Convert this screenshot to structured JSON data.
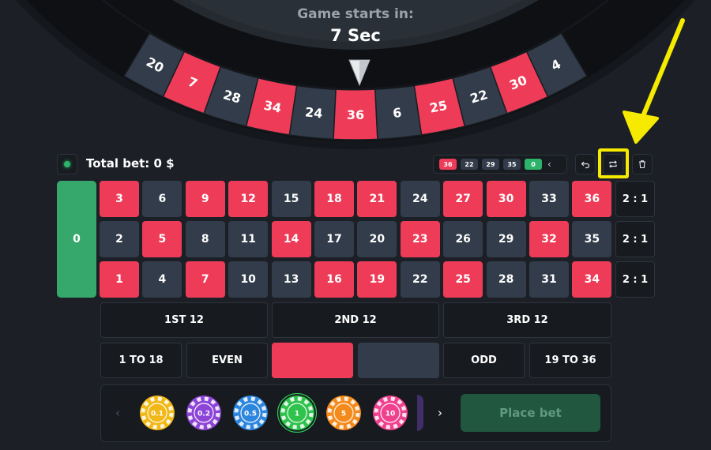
{
  "countdown": {
    "label": "Game starts in:",
    "value": "7 Sec"
  },
  "wheel": {
    "pockets": [
      {
        "number": "20",
        "color": "dark"
      },
      {
        "number": "7",
        "color": "red"
      },
      {
        "number": "28",
        "color": "dark"
      },
      {
        "number": "34",
        "color": "red"
      },
      {
        "number": "24",
        "color": "dark"
      },
      {
        "number": "36",
        "color": "red"
      },
      {
        "number": "6",
        "color": "dark"
      },
      {
        "number": "25",
        "color": "red"
      },
      {
        "number": "22",
        "color": "dark"
      },
      {
        "number": "30",
        "color": "red"
      },
      {
        "number": "4",
        "color": "dark"
      }
    ]
  },
  "header": {
    "total_bet": "Total bet: 0 $"
  },
  "history": [
    {
      "number": "36",
      "color": "red"
    },
    {
      "number": "22",
      "color": "dark"
    },
    {
      "number": "29",
      "color": "dark"
    },
    {
      "number": "35",
      "color": "dark"
    },
    {
      "number": "0",
      "color": "green"
    }
  ],
  "toolbar": {
    "undo_icon": "undo-icon",
    "repeat_icon": "repeat-icon",
    "clear_icon": "trash-icon"
  },
  "table": {
    "zero": "0",
    "rows": [
      [
        {
          "n": "3",
          "c": "red"
        },
        {
          "n": "6",
          "c": "dark"
        },
        {
          "n": "9",
          "c": "red"
        },
        {
          "n": "12",
          "c": "red"
        },
        {
          "n": "15",
          "c": "dark"
        },
        {
          "n": "18",
          "c": "red"
        },
        {
          "n": "21",
          "c": "red"
        },
        {
          "n": "24",
          "c": "dark"
        },
        {
          "n": "27",
          "c": "red"
        },
        {
          "n": "30",
          "c": "red"
        },
        {
          "n": "33",
          "c": "dark"
        },
        {
          "n": "36",
          "c": "red"
        }
      ],
      [
        {
          "n": "2",
          "c": "dark"
        },
        {
          "n": "5",
          "c": "red"
        },
        {
          "n": "8",
          "c": "dark"
        },
        {
          "n": "11",
          "c": "dark"
        },
        {
          "n": "14",
          "c": "red"
        },
        {
          "n": "17",
          "c": "dark"
        },
        {
          "n": "20",
          "c": "dark"
        },
        {
          "n": "23",
          "c": "red"
        },
        {
          "n": "26",
          "c": "dark"
        },
        {
          "n": "29",
          "c": "dark"
        },
        {
          "n": "32",
          "c": "red"
        },
        {
          "n": "35",
          "c": "dark"
        }
      ],
      [
        {
          "n": "1",
          "c": "red"
        },
        {
          "n": "4",
          "c": "dark"
        },
        {
          "n": "7",
          "c": "red"
        },
        {
          "n": "10",
          "c": "dark"
        },
        {
          "n": "13",
          "c": "dark"
        },
        {
          "n": "16",
          "c": "red"
        },
        {
          "n": "19",
          "c": "red"
        },
        {
          "n": "22",
          "c": "dark"
        },
        {
          "n": "25",
          "c": "red"
        },
        {
          "n": "28",
          "c": "dark"
        },
        {
          "n": "31",
          "c": "dark"
        },
        {
          "n": "34",
          "c": "red"
        }
      ]
    ],
    "column_bets": [
      "2 : 1",
      "2 : 1",
      "2 : 1"
    ],
    "dozens": [
      "1ST 12",
      "2ND 12",
      "3RD 12"
    ],
    "even_money": {
      "low": "1 TO 18",
      "even": "EVEN",
      "odd": "ODD",
      "high": "19 TO 36"
    }
  },
  "chips": {
    "values": [
      {
        "label": "0.1",
        "color": "#f2b817",
        "selected": false
      },
      {
        "label": "0.2",
        "color": "#8d45d8",
        "selected": false
      },
      {
        "label": "0.5",
        "color": "#2d86de",
        "selected": false
      },
      {
        "label": "1",
        "color": "#2fc24d",
        "selected": true
      },
      {
        "label": "5",
        "color": "#f48a1c",
        "selected": false
      },
      {
        "label": "10",
        "color": "#f0418e",
        "selected": false
      }
    ],
    "prev_icon": "chevron-left-icon",
    "next_icon": "chevron-right-icon"
  },
  "place_bet": "Place bet",
  "colors": {
    "red": "#ee3c58",
    "dark": "#323c4a",
    "green": "#36a86c",
    "background": "#1c2026",
    "highlight": "#f5ea00"
  }
}
